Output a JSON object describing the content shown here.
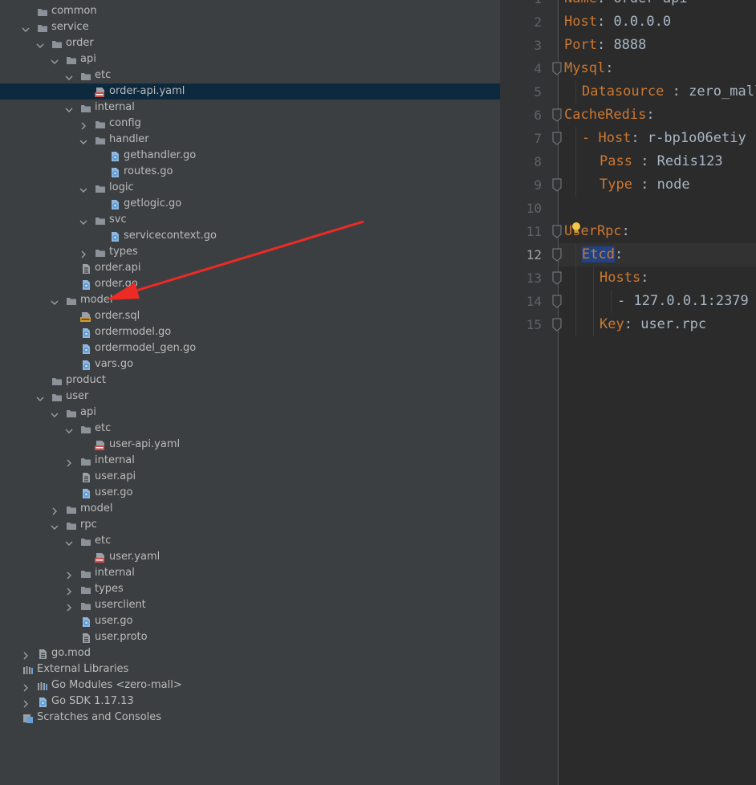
{
  "tree": [
    {
      "label": "common",
      "type": "folder",
      "depth": 1,
      "expand": "none"
    },
    {
      "label": "service",
      "type": "folder",
      "depth": 1,
      "expand": "open"
    },
    {
      "label": "order",
      "type": "folder",
      "depth": 2,
      "expand": "open"
    },
    {
      "label": "api",
      "type": "folder",
      "depth": 3,
      "expand": "open"
    },
    {
      "label": "etc",
      "type": "folder",
      "depth": 4,
      "expand": "open"
    },
    {
      "label": "order-api.yaml",
      "type": "yaml",
      "depth": 5,
      "expand": "none",
      "selected": true
    },
    {
      "label": "internal",
      "type": "folder",
      "depth": 4,
      "expand": "open"
    },
    {
      "label": "config",
      "type": "folder",
      "depth": 5,
      "expand": "closed"
    },
    {
      "label": "handler",
      "type": "folder",
      "depth": 5,
      "expand": "open"
    },
    {
      "label": "gethandler.go",
      "type": "go",
      "depth": 6,
      "expand": "none"
    },
    {
      "label": "routes.go",
      "type": "go",
      "depth": 6,
      "expand": "none"
    },
    {
      "label": "logic",
      "type": "folder",
      "depth": 5,
      "expand": "open"
    },
    {
      "label": "getlogic.go",
      "type": "go",
      "depth": 6,
      "expand": "none"
    },
    {
      "label": "svc",
      "type": "folder",
      "depth": 5,
      "expand": "open"
    },
    {
      "label": "servicecontext.go",
      "type": "go",
      "depth": 6,
      "expand": "none"
    },
    {
      "label": "types",
      "type": "folder",
      "depth": 5,
      "expand": "closed"
    },
    {
      "label": "order.api",
      "type": "file",
      "depth": 4,
      "expand": "none"
    },
    {
      "label": "order.go",
      "type": "go",
      "depth": 4,
      "expand": "none"
    },
    {
      "label": "model",
      "type": "folder",
      "depth": 3,
      "expand": "open"
    },
    {
      "label": "order.sql",
      "type": "sql",
      "depth": 4,
      "expand": "none"
    },
    {
      "label": "ordermodel.go",
      "type": "go",
      "depth": 4,
      "expand": "none"
    },
    {
      "label": "ordermodel_gen.go",
      "type": "go",
      "depth": 4,
      "expand": "none"
    },
    {
      "label": "vars.go",
      "type": "go",
      "depth": 4,
      "expand": "none"
    },
    {
      "label": "product",
      "type": "folder",
      "depth": 2,
      "expand": "none"
    },
    {
      "label": "user",
      "type": "folder",
      "depth": 2,
      "expand": "open"
    },
    {
      "label": "api",
      "type": "folder",
      "depth": 3,
      "expand": "open"
    },
    {
      "label": "etc",
      "type": "folder",
      "depth": 4,
      "expand": "open"
    },
    {
      "label": "user-api.yaml",
      "type": "yaml",
      "depth": 5,
      "expand": "none"
    },
    {
      "label": "internal",
      "type": "folder",
      "depth": 4,
      "expand": "closed"
    },
    {
      "label": "user.api",
      "type": "file",
      "depth": 4,
      "expand": "none"
    },
    {
      "label": "user.go",
      "type": "go",
      "depth": 4,
      "expand": "none"
    },
    {
      "label": "model",
      "type": "folder",
      "depth": 3,
      "expand": "closed"
    },
    {
      "label": "rpc",
      "type": "folder",
      "depth": 3,
      "expand": "open"
    },
    {
      "label": "etc",
      "type": "folder",
      "depth": 4,
      "expand": "open"
    },
    {
      "label": "user.yaml",
      "type": "yaml",
      "depth": 5,
      "expand": "none"
    },
    {
      "label": "internal",
      "type": "folder",
      "depth": 4,
      "expand": "closed"
    },
    {
      "label": "types",
      "type": "folder",
      "depth": 4,
      "expand": "closed"
    },
    {
      "label": "userclient",
      "type": "folder",
      "depth": 4,
      "expand": "closed"
    },
    {
      "label": "user.go",
      "type": "go",
      "depth": 4,
      "expand": "none"
    },
    {
      "label": "user.proto",
      "type": "file",
      "depth": 4,
      "expand": "none"
    },
    {
      "label": "go.mod",
      "type": "file",
      "depth": 1,
      "expand": "closed"
    },
    {
      "label": "External Libraries",
      "type": "lib",
      "depth": 0,
      "expand": "none"
    },
    {
      "label": "Go Modules <zero-mall>",
      "type": "lib",
      "depth": 1,
      "expand": "closed"
    },
    {
      "label": "Go SDK 1.17.13",
      "type": "go",
      "depth": 1,
      "expand": "closed"
    },
    {
      "label": "Scratches and Consoles",
      "type": "scratch",
      "depth": 0,
      "expand": "none"
    }
  ],
  "editor": {
    "current_line": 12,
    "lines": [
      {
        "n": "1",
        "indent": 0,
        "key": "Name",
        "sep": ": ",
        "value": "order-api",
        "fold": false
      },
      {
        "n": "2",
        "indent": 0,
        "key": "Host",
        "sep": ": ",
        "value": "0.0.0.0",
        "fold": false
      },
      {
        "n": "3",
        "indent": 0,
        "key": "Port",
        "sep": ": ",
        "value": "8888",
        "fold": false
      },
      {
        "n": "4",
        "indent": 0,
        "key": "Mysql",
        "sep": ":",
        "value": "",
        "fold": true
      },
      {
        "n": "5",
        "indent": 1,
        "key": "Datasource",
        "sep": " : ",
        "value": "zero_mall",
        "fold": false
      },
      {
        "n": "6",
        "indent": 0,
        "key": "CacheRedis",
        "sep": ":",
        "value": "",
        "fold": true
      },
      {
        "n": "7",
        "indent": 1,
        "key": "- Host",
        "sep": ": ",
        "value": "r-bp1o06etiy",
        "fold": true
      },
      {
        "n": "8",
        "indent": 2,
        "key": "Pass",
        "sep": " : ",
        "value": "Redis123",
        "fold": false
      },
      {
        "n": "9",
        "indent": 2,
        "key": "Type",
        "sep": " : ",
        "value": "node",
        "fold": true
      },
      {
        "n": "10",
        "indent": 0,
        "key": "",
        "sep": "",
        "value": "",
        "fold": false
      },
      {
        "n": "11",
        "indent": 0,
        "key": "UserRpc",
        "sep": ":",
        "value": "",
        "fold": true
      },
      {
        "n": "12",
        "indent": 1,
        "key": "Etcd",
        "sep": ":",
        "value": "",
        "fold": true
      },
      {
        "n": "13",
        "indent": 2,
        "key": "Hosts",
        "sep": ":",
        "value": "",
        "fold": true
      },
      {
        "n": "14",
        "indent": 3,
        "key": "",
        "sep": "- ",
        "value": "127.0.0.1:2379",
        "fold": true
      },
      {
        "n": "15",
        "indent": 2,
        "key": "Key",
        "sep": ": ",
        "value": "user.rpc",
        "fold": true
      }
    ]
  },
  "colors": {
    "tree_bg": "#3c3f41",
    "selected_row": "#0d293e",
    "editor_bg": "#2b2b2b",
    "gutter": "#313335",
    "key": "#cc7832",
    "value": "#a9b7c6",
    "line_number": "#606366",
    "arrow": "#ee2a24",
    "folder": "#8c9299",
    "go": "#5b9ad6"
  }
}
